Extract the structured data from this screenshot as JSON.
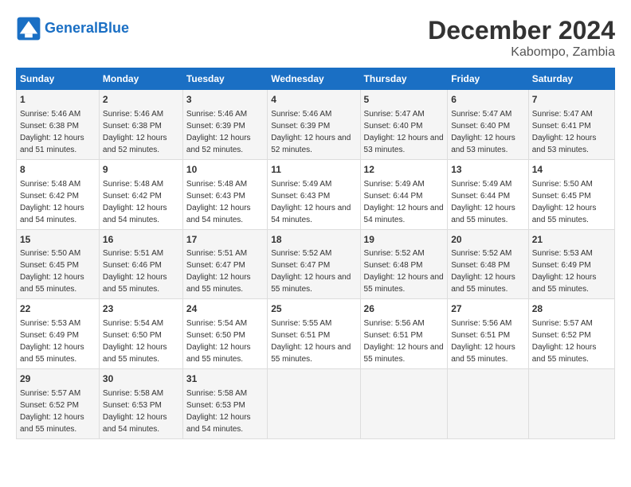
{
  "header": {
    "logo_line1": "General",
    "logo_line2": "Blue",
    "main_title": "December 2024",
    "subtitle": "Kabompo, Zambia"
  },
  "weekdays": [
    "Sunday",
    "Monday",
    "Tuesday",
    "Wednesday",
    "Thursday",
    "Friday",
    "Saturday"
  ],
  "weeks": [
    [
      {
        "day": "1",
        "sunrise": "Sunrise: 5:46 AM",
        "sunset": "Sunset: 6:38 PM",
        "daylight": "Daylight: 12 hours and 51 minutes."
      },
      {
        "day": "2",
        "sunrise": "Sunrise: 5:46 AM",
        "sunset": "Sunset: 6:38 PM",
        "daylight": "Daylight: 12 hours and 52 minutes."
      },
      {
        "day": "3",
        "sunrise": "Sunrise: 5:46 AM",
        "sunset": "Sunset: 6:39 PM",
        "daylight": "Daylight: 12 hours and 52 minutes."
      },
      {
        "day": "4",
        "sunrise": "Sunrise: 5:46 AM",
        "sunset": "Sunset: 6:39 PM",
        "daylight": "Daylight: 12 hours and 52 minutes."
      },
      {
        "day": "5",
        "sunrise": "Sunrise: 5:47 AM",
        "sunset": "Sunset: 6:40 PM",
        "daylight": "Daylight: 12 hours and 53 minutes."
      },
      {
        "day": "6",
        "sunrise": "Sunrise: 5:47 AM",
        "sunset": "Sunset: 6:40 PM",
        "daylight": "Daylight: 12 hours and 53 minutes."
      },
      {
        "day": "7",
        "sunrise": "Sunrise: 5:47 AM",
        "sunset": "Sunset: 6:41 PM",
        "daylight": "Daylight: 12 hours and 53 minutes."
      }
    ],
    [
      {
        "day": "8",
        "sunrise": "Sunrise: 5:48 AM",
        "sunset": "Sunset: 6:42 PM",
        "daylight": "Daylight: 12 hours and 54 minutes."
      },
      {
        "day": "9",
        "sunrise": "Sunrise: 5:48 AM",
        "sunset": "Sunset: 6:42 PM",
        "daylight": "Daylight: 12 hours and 54 minutes."
      },
      {
        "day": "10",
        "sunrise": "Sunrise: 5:48 AM",
        "sunset": "Sunset: 6:43 PM",
        "daylight": "Daylight: 12 hours and 54 minutes."
      },
      {
        "day": "11",
        "sunrise": "Sunrise: 5:49 AM",
        "sunset": "Sunset: 6:43 PM",
        "daylight": "Daylight: 12 hours and 54 minutes."
      },
      {
        "day": "12",
        "sunrise": "Sunrise: 5:49 AM",
        "sunset": "Sunset: 6:44 PM",
        "daylight": "Daylight: 12 hours and 54 minutes."
      },
      {
        "day": "13",
        "sunrise": "Sunrise: 5:49 AM",
        "sunset": "Sunset: 6:44 PM",
        "daylight": "Daylight: 12 hours and 55 minutes."
      },
      {
        "day": "14",
        "sunrise": "Sunrise: 5:50 AM",
        "sunset": "Sunset: 6:45 PM",
        "daylight": "Daylight: 12 hours and 55 minutes."
      }
    ],
    [
      {
        "day": "15",
        "sunrise": "Sunrise: 5:50 AM",
        "sunset": "Sunset: 6:45 PM",
        "daylight": "Daylight: 12 hours and 55 minutes."
      },
      {
        "day": "16",
        "sunrise": "Sunrise: 5:51 AM",
        "sunset": "Sunset: 6:46 PM",
        "daylight": "Daylight: 12 hours and 55 minutes."
      },
      {
        "day": "17",
        "sunrise": "Sunrise: 5:51 AM",
        "sunset": "Sunset: 6:47 PM",
        "daylight": "Daylight: 12 hours and 55 minutes."
      },
      {
        "day": "18",
        "sunrise": "Sunrise: 5:52 AM",
        "sunset": "Sunset: 6:47 PM",
        "daylight": "Daylight: 12 hours and 55 minutes."
      },
      {
        "day": "19",
        "sunrise": "Sunrise: 5:52 AM",
        "sunset": "Sunset: 6:48 PM",
        "daylight": "Daylight: 12 hours and 55 minutes."
      },
      {
        "day": "20",
        "sunrise": "Sunrise: 5:52 AM",
        "sunset": "Sunset: 6:48 PM",
        "daylight": "Daylight: 12 hours and 55 minutes."
      },
      {
        "day": "21",
        "sunrise": "Sunrise: 5:53 AM",
        "sunset": "Sunset: 6:49 PM",
        "daylight": "Daylight: 12 hours and 55 minutes."
      }
    ],
    [
      {
        "day": "22",
        "sunrise": "Sunrise: 5:53 AM",
        "sunset": "Sunset: 6:49 PM",
        "daylight": "Daylight: 12 hours and 55 minutes."
      },
      {
        "day": "23",
        "sunrise": "Sunrise: 5:54 AM",
        "sunset": "Sunset: 6:50 PM",
        "daylight": "Daylight: 12 hours and 55 minutes."
      },
      {
        "day": "24",
        "sunrise": "Sunrise: 5:54 AM",
        "sunset": "Sunset: 6:50 PM",
        "daylight": "Daylight: 12 hours and 55 minutes."
      },
      {
        "day": "25",
        "sunrise": "Sunrise: 5:55 AM",
        "sunset": "Sunset: 6:51 PM",
        "daylight": "Daylight: 12 hours and 55 minutes."
      },
      {
        "day": "26",
        "sunrise": "Sunrise: 5:56 AM",
        "sunset": "Sunset: 6:51 PM",
        "daylight": "Daylight: 12 hours and 55 minutes."
      },
      {
        "day": "27",
        "sunrise": "Sunrise: 5:56 AM",
        "sunset": "Sunset: 6:51 PM",
        "daylight": "Daylight: 12 hours and 55 minutes."
      },
      {
        "day": "28",
        "sunrise": "Sunrise: 5:57 AM",
        "sunset": "Sunset: 6:52 PM",
        "daylight": "Daylight: 12 hours and 55 minutes."
      }
    ],
    [
      {
        "day": "29",
        "sunrise": "Sunrise: 5:57 AM",
        "sunset": "Sunset: 6:52 PM",
        "daylight": "Daylight: 12 hours and 55 minutes."
      },
      {
        "day": "30",
        "sunrise": "Sunrise: 5:58 AM",
        "sunset": "Sunset: 6:53 PM",
        "daylight": "Daylight: 12 hours and 54 minutes."
      },
      {
        "day": "31",
        "sunrise": "Sunrise: 5:58 AM",
        "sunset": "Sunset: 6:53 PM",
        "daylight": "Daylight: 12 hours and 54 minutes."
      },
      null,
      null,
      null,
      null
    ]
  ]
}
